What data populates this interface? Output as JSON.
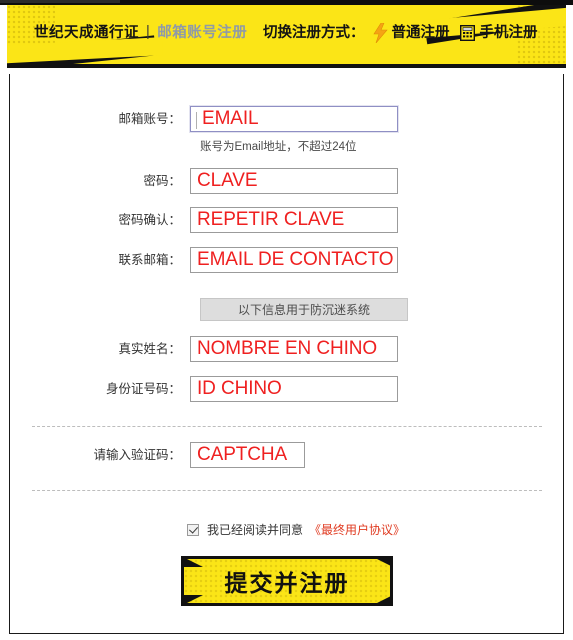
{
  "banner": {
    "brand_name": "世纪天成通行证",
    "separator": "|",
    "brand_sub": "邮箱账号注册",
    "switch_label": "切换注册方式：",
    "bolt_icon": "lightning-bolt-icon",
    "option_normal": "普通注册",
    "phone_icon": "mobile-phone-icon",
    "option_phone": "手机注册"
  },
  "form": {
    "fields": [
      {
        "label": "邮箱账号：",
        "value": "EMAIL",
        "hint": "账号为Email地址，不超过24位"
      },
      {
        "label": "密码：",
        "value": "CLAVE",
        "hint": ""
      },
      {
        "label": "密码确认：",
        "value": "REPETIR CLAVE",
        "hint": ""
      },
      {
        "label": "联系邮箱：",
        "value": "EMAIL DE CONTACTO",
        "hint": ""
      },
      {
        "label": "真实姓名：",
        "value": "NOMBRE EN CHINO",
        "hint": ""
      },
      {
        "label": "身份证号码：",
        "value": "ID CHINO",
        "hint": ""
      },
      {
        "label": "请输入验证码：",
        "value": "CAPTCHA",
        "hint": ""
      }
    ],
    "notice": "以下信息用于防沉迷系统"
  },
  "agreement": {
    "checked": true,
    "text": "我已经阅读并同意",
    "link": "《最终用户协议》"
  },
  "submit": {
    "label": "提交并注册"
  },
  "colors": {
    "banner_yellow": "#fbe517",
    "black": "#111111",
    "input_red": "#ef2020",
    "link_red": "#e03a20",
    "brand_sub_gray": "#8f9aa8",
    "notice_gray": "#dddddd"
  }
}
